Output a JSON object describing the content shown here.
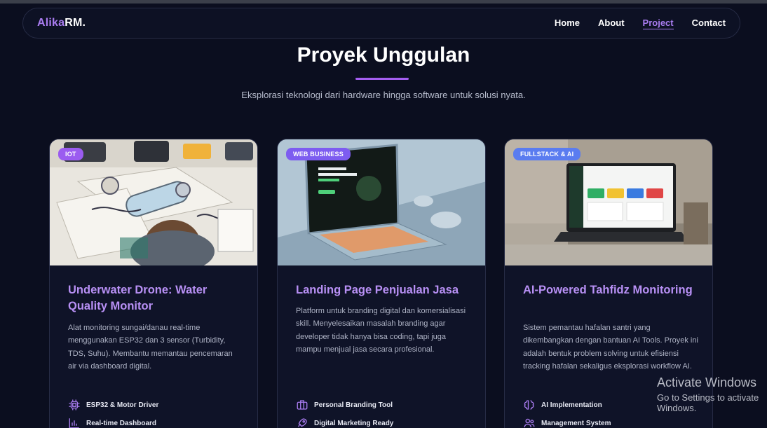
{
  "nav": {
    "brand_first": "Alika",
    "brand_second": "RM.",
    "links": [
      "Home",
      "About",
      "Project",
      "Contact"
    ],
    "active": "Project"
  },
  "header": {
    "title": "Proyek Unggulan",
    "subtitle": "Eksplorasi teknologi dari hardware hingga software untuk solusi nyata."
  },
  "cards": [
    {
      "badge": "IOT",
      "badge_color": "#9b5cf0",
      "title": "Underwater Drone: Water Quality Monitor",
      "description": "Alat monitoring sungai/danau real-time menggunakan ESP32 dan 3 sensor (Turbidity, TDS, Suhu). Membantu memantau pencemaran air via dashboard digital.",
      "features": [
        {
          "icon": "chip-icon",
          "label": "ESP32 & Motor Driver"
        },
        {
          "icon": "bar-chart-icon",
          "label": "Real-time Dashboard"
        }
      ]
    },
    {
      "badge": "WEB BUSINESS",
      "badge_color": "#7d5cf0",
      "title": "Landing Page Penjualan Jasa",
      "description": "Platform untuk branding digital dan komersialisasi skill. Menyelesaikan masalah branding agar developer tidak hanya bisa coding, tapi juga mampu menjual jasa secara profesional.",
      "features": [
        {
          "icon": "briefcase-icon",
          "label": "Personal Branding Tool"
        },
        {
          "icon": "rocket-icon",
          "label": "Digital Marketing Ready"
        }
      ]
    },
    {
      "badge": "FULLSTACK & AI",
      "badge_color": "#5a7cf0",
      "title": "AI-Powered Tahfidz Monitoring",
      "description": "Sistem pemantau hafalan santri yang dikembangkan dengan bantuan AI Tools. Proyek ini adalah bentuk problem solving untuk efisiensi tracking hafalan sekaligus eksplorasi workflow AI.",
      "features": [
        {
          "icon": "brain-icon",
          "label": "AI Implementation"
        },
        {
          "icon": "users-icon",
          "label": "Management System"
        }
      ]
    }
  ],
  "watermark": {
    "line1": "Activate Windows",
    "line2": "Go to Settings to activate Windows."
  }
}
